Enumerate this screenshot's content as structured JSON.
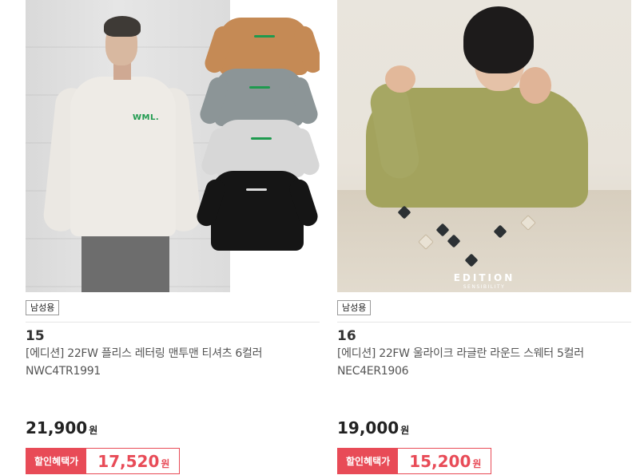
{
  "products": [
    {
      "tag": "남성용",
      "rank": "15",
      "title": "[에디션] 22FW 플리스 레터링 맨투맨 티셔츠 6컬러 NWC4TR1991",
      "price": "21,900",
      "price_unit": "원",
      "discount_label": "할인혜택가",
      "discount_price": "17,520",
      "discount_unit": "원",
      "image_logo_text": "WML."
    },
    {
      "tag": "남성용",
      "rank": "16",
      "title": "[에디션] 22FW 울라이크 라글란 라운드 스웨터 5컬러 NEC4ER1906",
      "price": "19,000",
      "price_unit": "원",
      "discount_label": "할인혜택가",
      "discount_price": "15,200",
      "discount_unit": "원",
      "image_brand_text": "EDITION",
      "image_brand_sub": "SENSIBILITY"
    }
  ],
  "colors": {
    "accent": "#e84b57",
    "tag_border": "#999999"
  }
}
